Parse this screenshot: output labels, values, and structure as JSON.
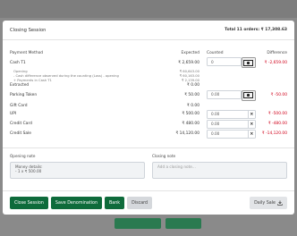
{
  "modal": {
    "title": "Closing Session",
    "total": "Total 11 orders: ₹ 17,308.63"
  },
  "columns": {
    "method": "Payment Method",
    "expected": "Expected",
    "counted": "Counted",
    "difference": "Difference"
  },
  "cash": {
    "label": "Cash T1",
    "expected": "₹ 2,659.00",
    "counted": "0",
    "difference": "₹ -2,659.00",
    "details": [
      {
        "label": "Opening",
        "value": "₹ 60,643.00"
      },
      {
        "label": "- Cash difference observed during the counting (Loss) - opening",
        "value": "₹ 60,163.00"
      },
      {
        "label": "+ Payments in Cash T1",
        "value": "₹ 2,139.00"
      }
    ],
    "extra_label": "Extracted",
    "extra_value": "₹ 0.00"
  },
  "parking": {
    "label": "Parking Token",
    "expected": "₹ 50.00",
    "counted": "0.00",
    "difference": "₹ -50.00"
  },
  "giftcard": {
    "label": "Gift Card",
    "expected": "₹ 0.00"
  },
  "upi": {
    "label": "UPI",
    "expected": "₹ 500.00",
    "counted": "0.00",
    "difference": "₹ -500.00"
  },
  "credit_card": {
    "label": "Credit Card",
    "expected": "₹ 480.00",
    "counted": "0.00",
    "difference": "₹ -480.00"
  },
  "credit_sale": {
    "label": "Credit Sale",
    "expected": "₹ 14,120.00",
    "counted": "0.00",
    "difference": "₹ -14,120.00"
  },
  "notes": {
    "opening_label": "Opening note",
    "opening_text_1": "Money details:",
    "opening_text_2": "- 1 x ₹ 500.00",
    "closing_label": "Closing note",
    "closing_placeholder": "Add a closing note..."
  },
  "footer": {
    "close": "Close Session",
    "save": "Save Denomination",
    "bank": "Bank",
    "discard": "Discard",
    "daily": "Daily Sale"
  },
  "icons": {
    "cash": "cash-icon",
    "clear": "clear-icon",
    "download": "download-icon"
  },
  "colors": {
    "primary": "#0e6b3b",
    "negative": "#d0021b"
  }
}
